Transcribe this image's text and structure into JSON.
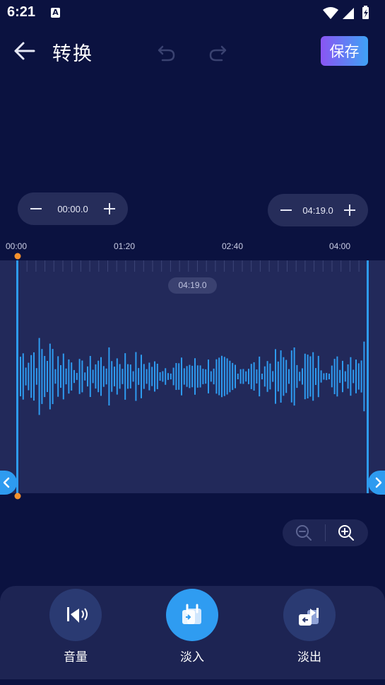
{
  "status_bar": {
    "time": "6:21",
    "notification_letter": "A"
  },
  "toolbar": {
    "title": "转换",
    "save_label": "保存"
  },
  "trim": {
    "start_time": "00:00.0",
    "end_time": "04:19.0"
  },
  "ruler": {
    "labels": [
      "00:00",
      "01:20",
      "02:40",
      "04:00"
    ]
  },
  "track": {
    "duration": "04:19.0",
    "wave_color": "#2e9bf0",
    "marker_color": "#f6912d"
  },
  "tools": [
    {
      "label": "音量",
      "icon": "volume-icon",
      "active": false
    },
    {
      "label": "淡入",
      "icon": "fade-in-icon",
      "active": true
    },
    {
      "label": "淡出",
      "icon": "fade-out-icon",
      "active": false
    }
  ],
  "colors": {
    "background": "#0b1240",
    "accent": "#2f9cf1",
    "save_gradient_start": "#8a55f3",
    "save_gradient_end": "#3fa2f5"
  }
}
